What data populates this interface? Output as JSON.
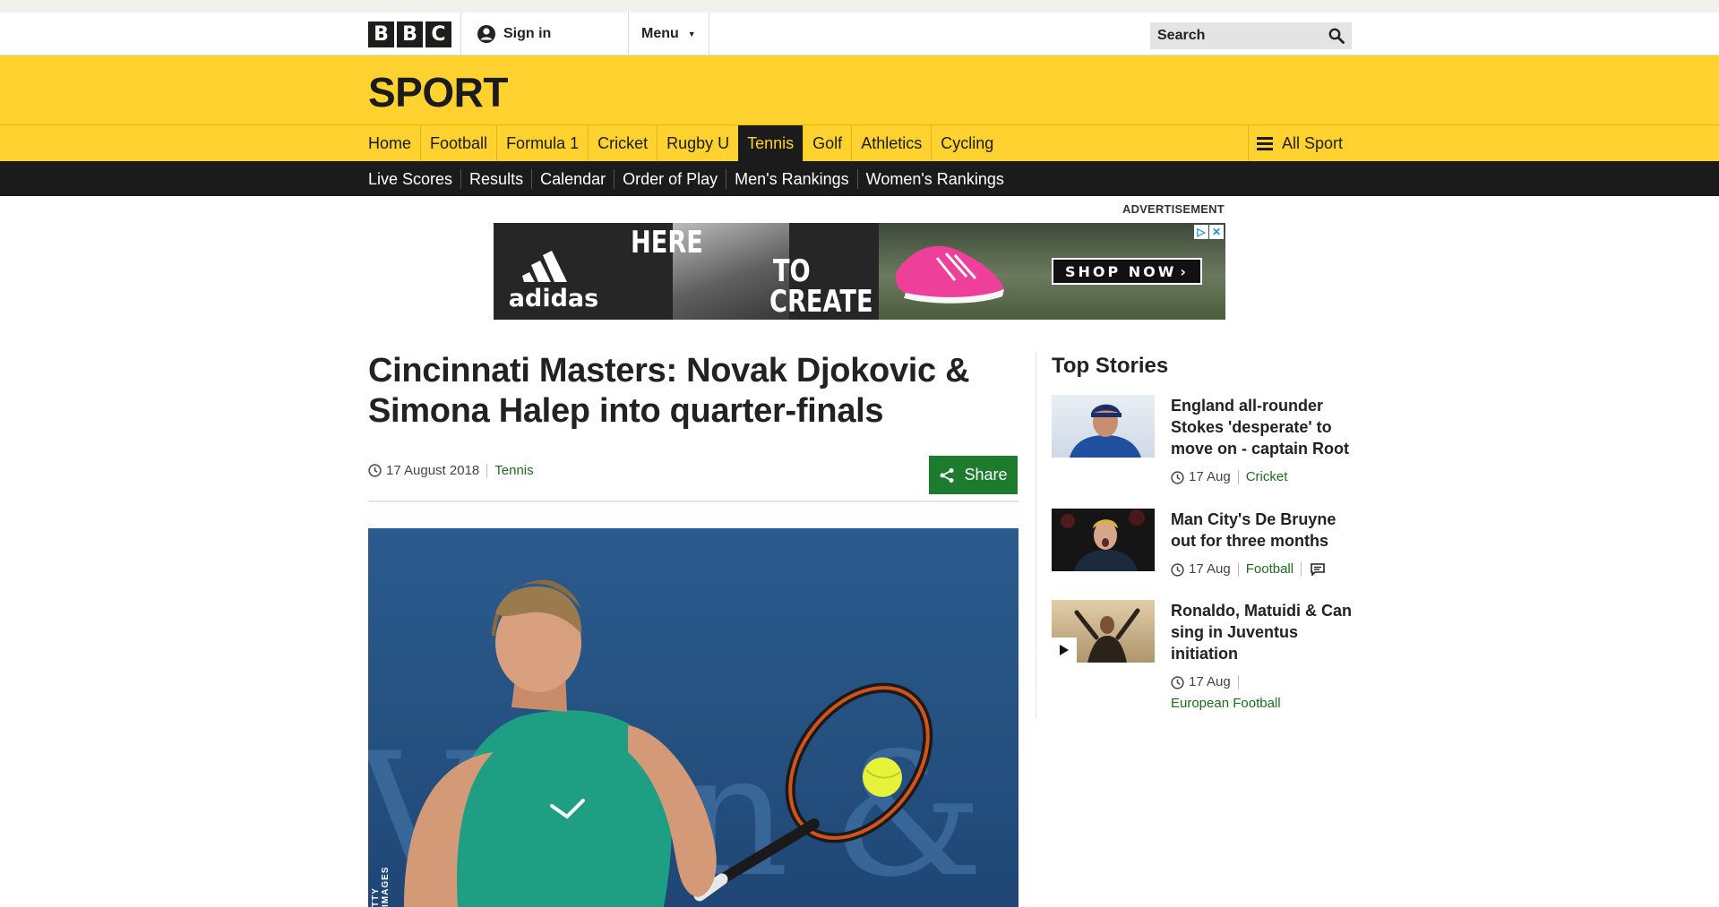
{
  "masthead": {
    "logo_letters": [
      "B",
      "B",
      "C"
    ],
    "signin_label": "Sign in",
    "menu_label": "Menu",
    "search_placeholder": "Search",
    "icons": {
      "signin": "user-icon",
      "menu": "caret-down-icon",
      "search": "magnifier-icon"
    }
  },
  "sport_header": {
    "title": "SPORT"
  },
  "nav_primary": {
    "items": [
      {
        "label": "Home"
      },
      {
        "label": "Football"
      },
      {
        "label": "Formula 1"
      },
      {
        "label": "Cricket"
      },
      {
        "label": "Rugby U"
      },
      {
        "label": "Tennis",
        "active": true
      },
      {
        "label": "Golf"
      },
      {
        "label": "Athletics"
      },
      {
        "label": "Cycling"
      }
    ],
    "all_sport_label": "All Sport"
  },
  "nav_secondary": {
    "items": [
      {
        "label": "Live Scores"
      },
      {
        "label": "Results"
      },
      {
        "label": "Calendar"
      },
      {
        "label": "Order of Play"
      },
      {
        "label": "Men's Rankings"
      },
      {
        "label": "Women's Rankings"
      }
    ]
  },
  "advert": {
    "label": "ADVERTISEMENT",
    "brand": "adidas",
    "line1": "HERE",
    "line2": "TO",
    "line3": "CREATE",
    "cta": "SHOP NOW"
  },
  "article": {
    "headline": "Cincinnati Masters: Novak Djokovic & Simona Halep into quarter-finals",
    "date": "17 August 2018",
    "section": "Tennis",
    "share_label": "Share",
    "image_credit": "TTY IMAGES",
    "image_bg_text": "Ve rn & S"
  },
  "sidebar": {
    "title": "Top Stories",
    "stories": [
      {
        "title": "England all-rounder Stokes 'desperate' to move on - captain Root",
        "date": "17 Aug",
        "section": "Cricket",
        "has_comments": false,
        "has_video": false
      },
      {
        "title": "Man City's De Bruyne out for three months",
        "date": "17 Aug",
        "section": "Football",
        "has_comments": true,
        "has_video": false
      },
      {
        "title": "Ronaldo, Matuidi & Can sing in Juventus initiation",
        "date": "17 Aug",
        "section": "European Football",
        "has_comments": false,
        "has_video": true
      }
    ]
  },
  "colors": {
    "sport_yellow": "#ffd230",
    "nav_dark": "#1b1b1b",
    "share_green": "#1d7b2e",
    "link_green": "#1d6b1e"
  }
}
